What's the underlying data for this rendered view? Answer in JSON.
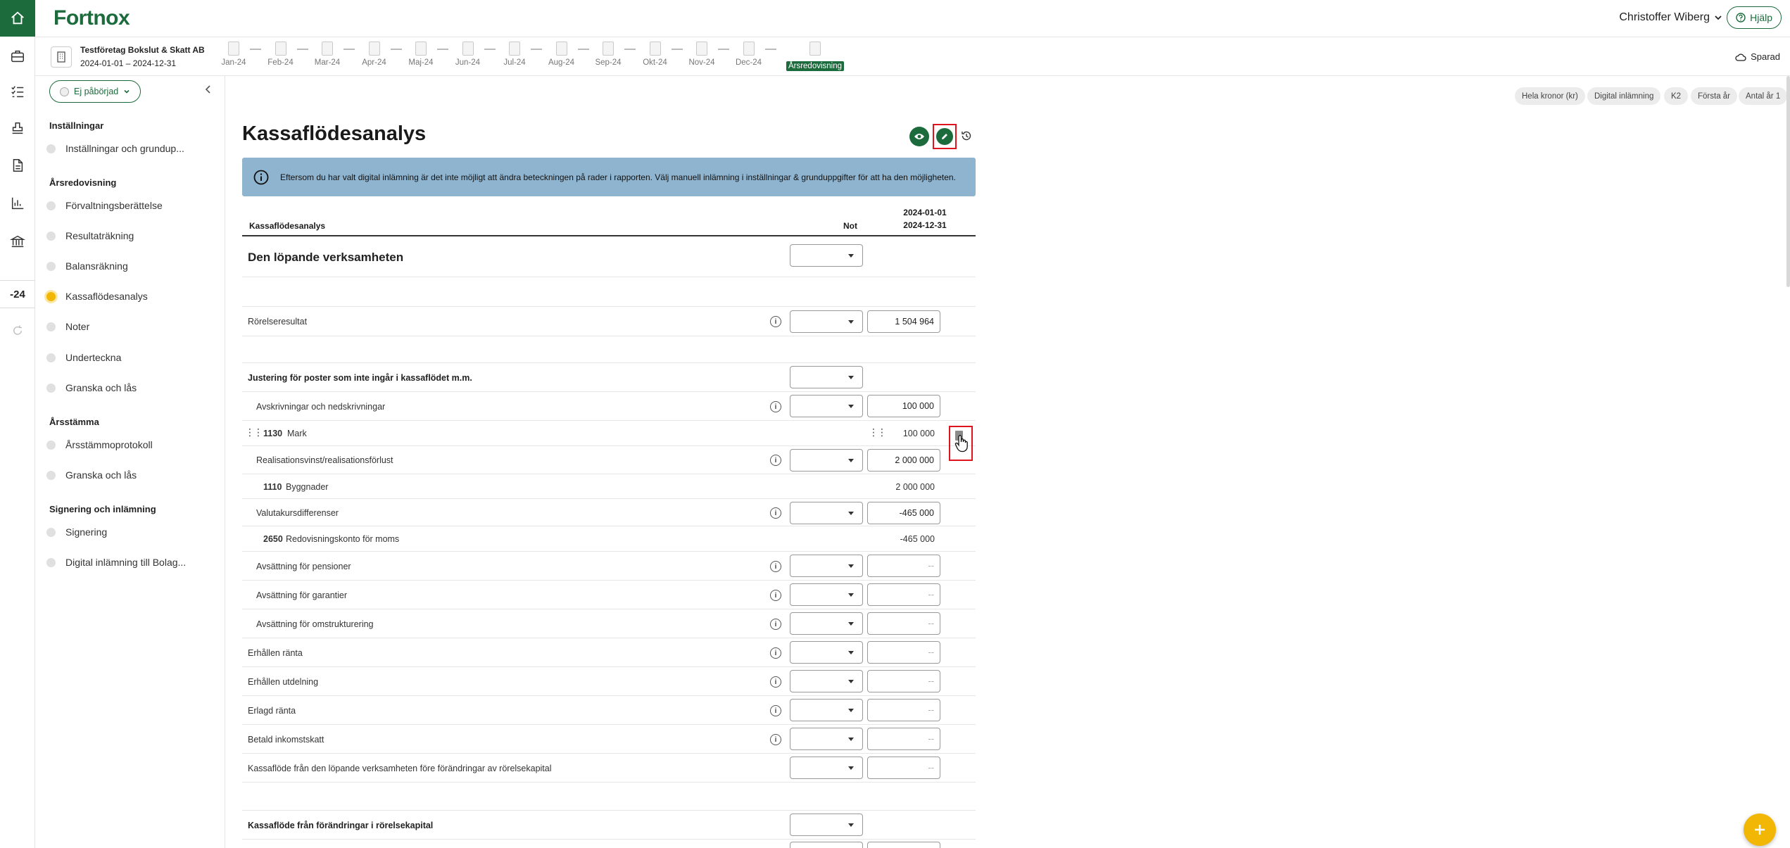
{
  "app": {
    "logo": "Fortnox",
    "user": "Christoffer Wiberg",
    "help": "Hjälp",
    "saved": "Sparad"
  },
  "company": {
    "name": "Testföretag Bokslut & Skatt AB",
    "period": "2024-01-01 – 2024-12-31"
  },
  "months": [
    "Jan-24",
    "Feb-24",
    "Mar-24",
    "Apr-24",
    "Maj-24",
    "Jun-24",
    "Jul-24",
    "Aug-24",
    "Sep-24",
    "Okt-24",
    "Nov-24",
    "Dec-24",
    "Årsredovisning"
  ],
  "active_month": "Årsredovisning",
  "rail": {
    "year": "-24"
  },
  "nav": {
    "status": "Ej påbörjad",
    "sections": [
      {
        "title": "Inställningar",
        "items": [
          "Inställningar och grundup..."
        ]
      },
      {
        "title": "Årsredovisning",
        "items": [
          "Förvaltningsberättelse",
          "Resultaträkning",
          "Balansräkning",
          "Kassaflödesanalys",
          "Noter",
          "Underteckna",
          "Granska och lås"
        ]
      },
      {
        "title": "Årsstämma",
        "items": [
          "Årsstämmoprotokoll",
          "Granska och lås"
        ]
      },
      {
        "title": "Signering och inlämning",
        "items": [
          "Signering",
          "Digital inlämning till Bolag..."
        ]
      }
    ],
    "active_item": "Kassaflödesanalys"
  },
  "chips": [
    "Hela kronor (kr)",
    "Digital inlämning",
    "K2",
    "Första år",
    "Antal år 1"
  ],
  "page": {
    "title": "Kassaflödesanalys",
    "info": "Eftersom du har valt digital inlämning är det inte möjligt att ändra beteckningen på rader i rapporten. Välj manuell inlämning i inställningar & grunduppgifter för att ha den möjligheten."
  },
  "table": {
    "header": {
      "label": "Kassaflödesanalys",
      "not": "Not",
      "period_start": "2024-01-01",
      "period_end": "2024-12-31"
    },
    "rows": {
      "r0": {
        "label": "Den löpande verksamheten"
      },
      "r1": {
        "label": "Rörelseresultat",
        "value": "1 504 964"
      },
      "r2": {
        "label": "Justering för poster som inte ingår i kassaflödet m.m."
      },
      "r3": {
        "label": "Avskrivningar och nedskrivningar",
        "value": "100 000"
      },
      "r4": {
        "account": "1130",
        "name": "Mark",
        "value": "100 000"
      },
      "r5": {
        "label": "Realisationsvinst/realisationsförlust",
        "value": "2 000 000"
      },
      "r6": {
        "account": "1110",
        "name": "Byggnader",
        "value": "2 000 000"
      },
      "r7": {
        "label": "Valutakursdifferenser",
        "value": "-465 000"
      },
      "r8": {
        "account": "2650",
        "name": "Redovisningskonto för moms",
        "value": "-465 000"
      },
      "r9": {
        "label": "Avsättning för pensioner",
        "value": "--"
      },
      "r10": {
        "label": "Avsättning för garantier",
        "value": "--"
      },
      "r11": {
        "label": "Avsättning för omstrukturering",
        "value": "--"
      },
      "r12": {
        "label": "Erhållen ränta",
        "value": "--"
      },
      "r13": {
        "label": "Erhållen utdelning",
        "value": "--"
      },
      "r14": {
        "label": "Erlagd ränta",
        "value": "--"
      },
      "r15": {
        "label": "Betald inkomstskatt",
        "value": "--"
      },
      "r16": {
        "label": "Kassaflöde från den löpande verksamheten före förändringar av rörelsekapital",
        "value": "--"
      },
      "r17": {
        "label": "Kassaflöde från förändringar i rörelsekapital"
      }
    }
  },
  "colors": {
    "brand": "#1c6b3c",
    "accent": "#f2b705",
    "info_bg": "#8fb4cf",
    "highlight": "#e0141e"
  }
}
